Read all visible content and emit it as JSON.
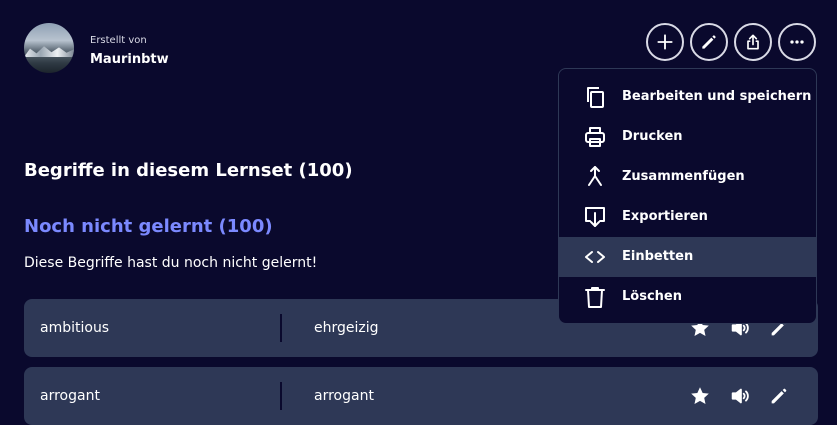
{
  "creator": {
    "caption": "Erstellt von",
    "name": "Maurinbtw"
  },
  "header_actions": [
    {
      "name": "add",
      "icon": "plus-icon"
    },
    {
      "name": "edit",
      "icon": "pencil-icon"
    },
    {
      "name": "share",
      "icon": "share-icon"
    },
    {
      "name": "more",
      "icon": "more-horizontal-icon"
    }
  ],
  "section": {
    "title": "Begriffe in diesem Lernset (100)",
    "group_title": "Noch nicht gelernt (100)",
    "group_desc": "Diese Begriffe hast du noch nicht gelernt!"
  },
  "terms": [
    {
      "term": "ambitious",
      "definition": "ehrgeizig"
    },
    {
      "term": "arrogant",
      "definition": "arrogant"
    }
  ],
  "menu": {
    "items": [
      {
        "label": "Bearbeiten und speichern",
        "icon": "copy-icon"
      },
      {
        "label": "Drucken",
        "icon": "printer-icon"
      },
      {
        "label": "Zusammenfügen",
        "icon": "merge-icon"
      },
      {
        "label": "Exportieren",
        "icon": "export-icon"
      },
      {
        "label": "Einbetten",
        "icon": "code-icon"
      },
      {
        "label": "Löschen",
        "icon": "trash-icon"
      }
    ],
    "active_label": "Einbetten"
  },
  "colors": {
    "background": "#0a092d",
    "row": "#2e3856",
    "accent": "#7b89ff",
    "text": "#ffffff"
  }
}
